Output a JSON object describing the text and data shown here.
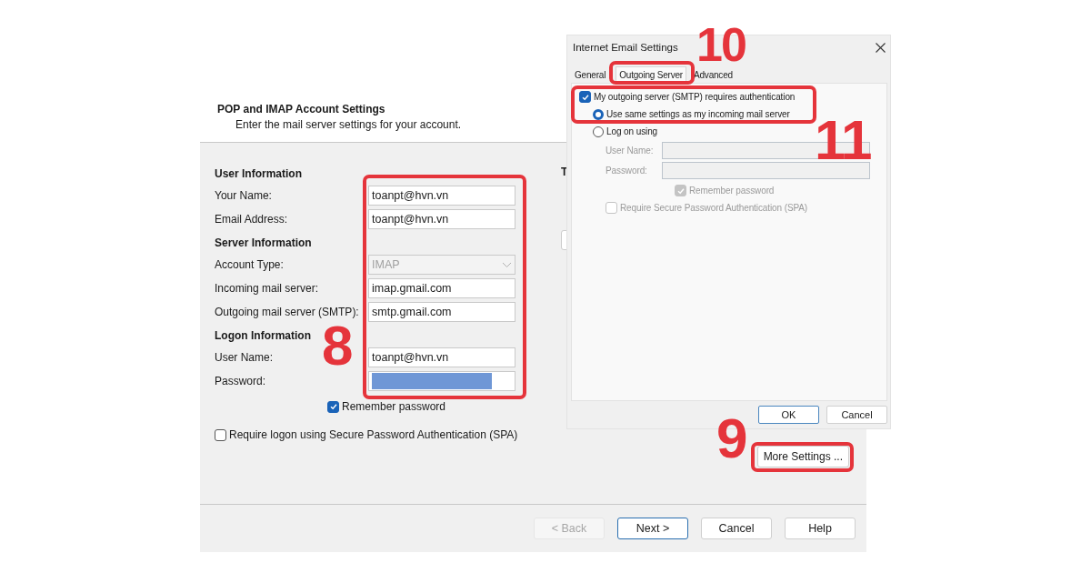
{
  "main_dialog": {
    "title": "POP and IMAP Account Settings",
    "subtitle": "Enter the mail server settings for your account.",
    "sections": [
      {
        "heading": "User Information",
        "fields": [
          {
            "label": "Your Name:",
            "value": "toanpt@hvn.vn",
            "kind": "text"
          },
          {
            "label": "Email Address:",
            "value": "toanpt@hvn.vn",
            "kind": "text"
          }
        ]
      },
      {
        "heading": "Server Information",
        "fields": [
          {
            "label": "Account Type:",
            "value": "IMAP",
            "kind": "dropdown",
            "disabled": true
          },
          {
            "label": "Incoming mail server:",
            "value": "imap.gmail.com",
            "kind": "text"
          },
          {
            "label": "Outgoing mail server (SMTP):",
            "value": "smtp.gmail.com",
            "kind": "text"
          }
        ]
      },
      {
        "heading": "Logon Information",
        "fields": [
          {
            "label": "User Name:",
            "value": "toanpt@hvn.vn",
            "kind": "text"
          },
          {
            "label": "Password:",
            "kind": "password"
          }
        ]
      }
    ],
    "remember_password": {
      "label": "Remember password",
      "checked": true
    },
    "spa": {
      "label": "Require logon using Secure Password Authentication (SPA)",
      "checked": false
    },
    "cut_off_texts": [
      "T"
    ],
    "more_settings_button": "More Settings ...",
    "buttons": [
      {
        "label": "< Back",
        "disabled": true,
        "default": false
      },
      {
        "label": "Next >",
        "disabled": false,
        "default": true
      },
      {
        "label": "Cancel",
        "disabled": false,
        "default": false
      },
      {
        "label": "Help",
        "disabled": false,
        "default": false
      }
    ]
  },
  "settings_dialog": {
    "title": "Internet Email Settings",
    "tabs": [
      {
        "label": "General",
        "selected": false
      },
      {
        "label": "Outgoing Server",
        "selected": true
      },
      {
        "label": "Advanced",
        "selected": false
      }
    ],
    "auth": {
      "label": "My outgoing server (SMTP) requires authentication",
      "checked": true
    },
    "radios": [
      {
        "label": "Use same settings as my incoming mail server",
        "selected": true
      },
      {
        "label": "Log on using",
        "selected": false
      }
    ],
    "logon_disabled": true,
    "logon_fields": [
      {
        "label": "User Name:"
      },
      {
        "label": "Password:"
      }
    ],
    "logon_remember": {
      "label": "Remember password",
      "checked": true
    },
    "logon_spa": {
      "label": "Require Secure Password Authentication (SPA)",
      "checked": false
    },
    "buttons": [
      {
        "label": "OK",
        "default": true
      },
      {
        "label": "Cancel",
        "default": false
      }
    ]
  },
  "annotations": [
    {
      "number": "8"
    },
    {
      "number": "9"
    },
    {
      "number": "10"
    },
    {
      "number": "11"
    }
  ]
}
